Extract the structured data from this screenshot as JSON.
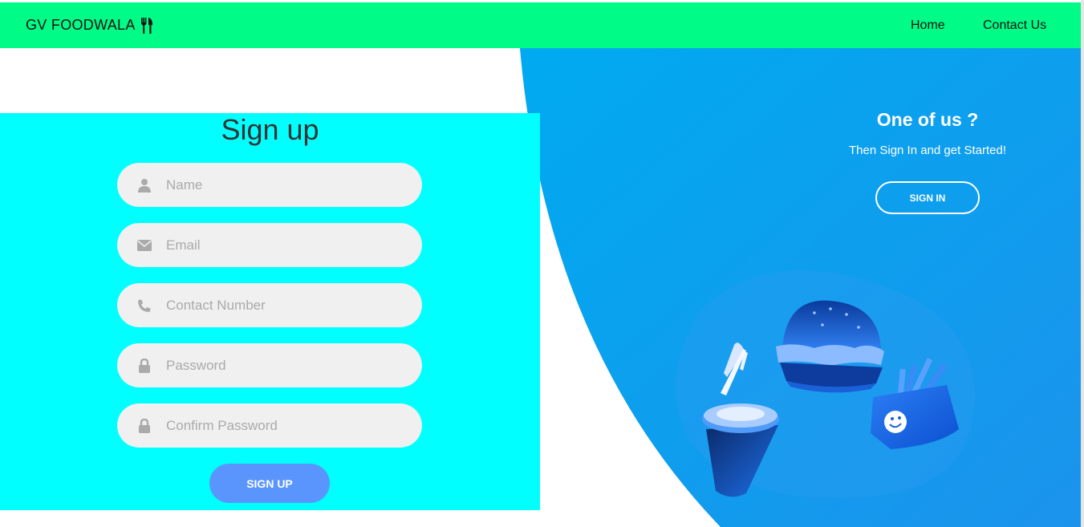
{
  "navbar": {
    "brand": "GV FOODWALA",
    "brand_icon": "fork-knife-icon",
    "links": [
      "Home",
      "Contact Us"
    ]
  },
  "signup": {
    "title": "Sign up",
    "fields": {
      "name": {
        "placeholder": "Name",
        "icon": "user-icon"
      },
      "email": {
        "placeholder": "Email",
        "icon": "envelope-icon"
      },
      "contact": {
        "placeholder": "Contact Number",
        "icon": "phone-icon"
      },
      "password": {
        "placeholder": "Password",
        "icon": "lock-icon"
      },
      "confirm": {
        "placeholder": "Confirm Password",
        "icon": "lock-icon"
      }
    },
    "submit_label": "SIGN UP"
  },
  "signin_panel": {
    "heading": "One of us ?",
    "subtext": "Then Sign In and get Started!",
    "button_label": "SIGN IN",
    "illustration": "fast-food-illustration"
  },
  "colors": {
    "navbar": "#00fc87",
    "form_panel": "#00ffff",
    "right_panel": "#0ea0ee",
    "signup_button": "#5995fd",
    "field_bg": "#f0f0f0"
  }
}
